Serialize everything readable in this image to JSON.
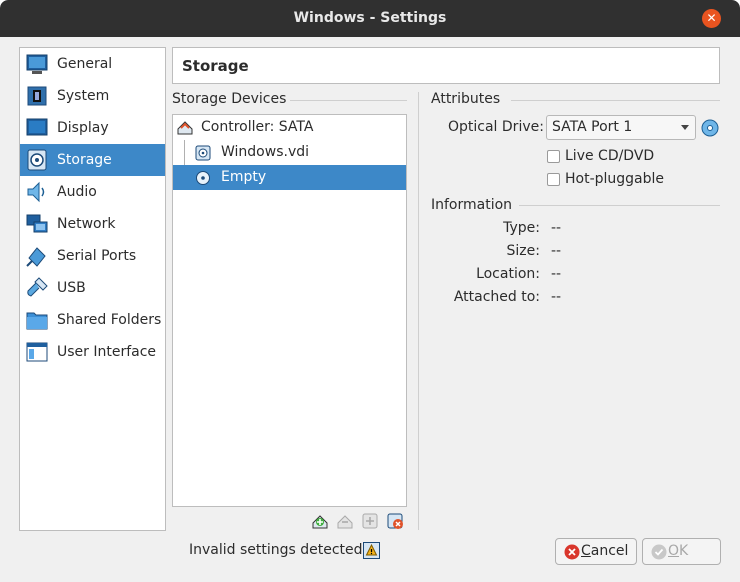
{
  "window": {
    "title": "Windows - Settings"
  },
  "nav": {
    "items": [
      {
        "label": "General",
        "icon": "general-icon"
      },
      {
        "label": "System",
        "icon": "system-icon"
      },
      {
        "label": "Display",
        "icon": "display-icon"
      },
      {
        "label": "Storage",
        "icon": "storage-icon",
        "selected": true
      },
      {
        "label": "Audio",
        "icon": "audio-icon"
      },
      {
        "label": "Network",
        "icon": "network-icon"
      },
      {
        "label": "Serial Ports",
        "icon": "serial-ports-icon"
      },
      {
        "label": "USB",
        "icon": "usb-icon"
      },
      {
        "label": "Shared Folders",
        "icon": "shared-folders-icon"
      },
      {
        "label": "User Interface",
        "icon": "user-interface-icon"
      }
    ]
  },
  "page": {
    "title": "Storage"
  },
  "storage_devices": {
    "label": "Storage Devices",
    "tree": [
      {
        "label": "Controller: SATA",
        "icon": "controller-icon",
        "level": 0
      },
      {
        "label": "Windows.vdi",
        "icon": "hard-disk-icon",
        "level": 1
      },
      {
        "label": "Empty",
        "icon": "optical-disc-icon",
        "level": 1,
        "selected": true
      }
    ],
    "toolbar": [
      "add-controller-icon",
      "remove-controller-icon",
      "add-attachment-icon",
      "remove-attachment-icon"
    ]
  },
  "attributes": {
    "label": "Attributes",
    "optical_drive_label": "Optical Drive:",
    "optical_drive_value": "SATA Port 1",
    "live_cd_label": "Live CD/DVD",
    "live_cd_checked": false,
    "hot_pluggable_label": "Hot-pluggable",
    "hot_pluggable_checked": false
  },
  "information": {
    "label": "Information",
    "type_label": "Type:",
    "type_value": "--",
    "size_label": "Size:",
    "size_value": "--",
    "location_label": "Location:",
    "location_value": "--",
    "attached_label": "Attached to:",
    "attached_value": "--"
  },
  "footer": {
    "status": "Invalid settings detected",
    "cancel_label": "Cancel",
    "ok_label": "OK"
  },
  "colors": {
    "selection": "#3d88c8",
    "titlebar": "#303030",
    "close": "#e95420"
  }
}
